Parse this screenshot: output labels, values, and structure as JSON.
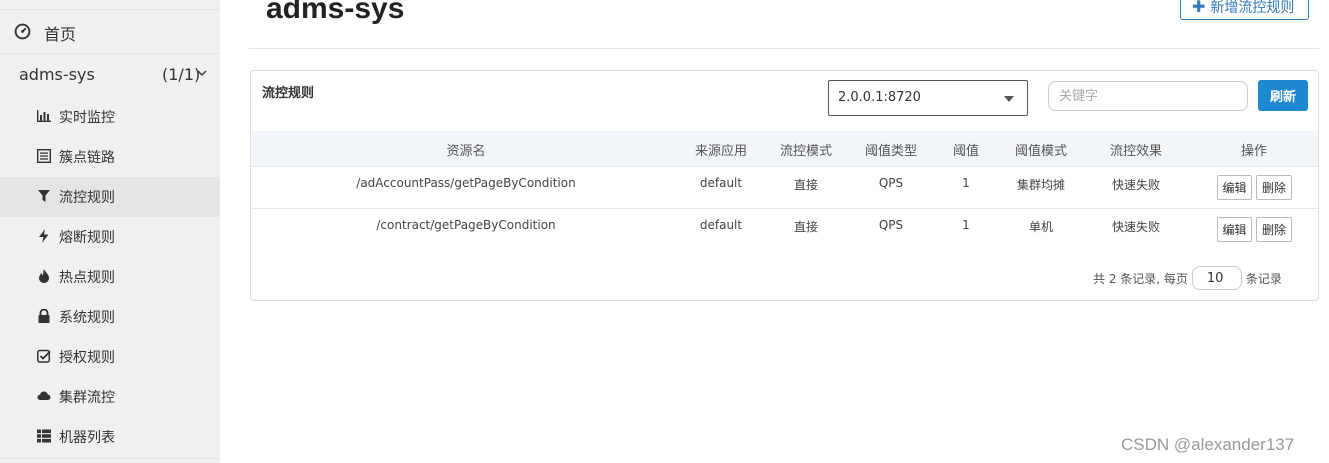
{
  "sidebar": {
    "home_label": "首页",
    "app_name": "adms-sys",
    "app_count": "(1/1)",
    "items": [
      {
        "label": "实时监控",
        "icon": "bar-chart-icon"
      },
      {
        "label": "簇点链路",
        "icon": "list-icon"
      },
      {
        "label": "流控规则",
        "icon": "filter-icon",
        "active": true
      },
      {
        "label": "熔断规则",
        "icon": "flash-icon"
      },
      {
        "label": "热点规则",
        "icon": "fire-icon"
      },
      {
        "label": "系统规则",
        "icon": "lock-icon"
      },
      {
        "label": "授权规则",
        "icon": "check-square-icon"
      },
      {
        "label": "集群流控",
        "icon": "cloud-icon"
      },
      {
        "label": "机器列表",
        "icon": "th-list-icon"
      }
    ]
  },
  "header": {
    "title": "adms-sys",
    "add_button": "新增流控规则",
    "add_icon": "plus-icon"
  },
  "panel": {
    "title": "流控规则",
    "machine_select": "2.0.0.1:8720",
    "keyword_placeholder": "关键字",
    "refresh_button": "刷新"
  },
  "table": {
    "columns": [
      "资源名",
      "来源应用",
      "流控模式",
      "阈值类型",
      "阈值",
      "阈值模式",
      "流控效果",
      "操作"
    ],
    "rows": [
      {
        "resource": "/adAccountPass/getPageByCondition",
        "limit_app": "default",
        "strategy": "直接",
        "grade": "QPS",
        "count": "1",
        "cluster_mode": "集群均摊",
        "control": "快速失败",
        "edit": "编辑",
        "delete": "删除"
      },
      {
        "resource": "/contract/getPageByCondition",
        "limit_app": "default",
        "strategy": "直接",
        "grade": "QPS",
        "count": "1",
        "cluster_mode": "单机",
        "control": "快速失败",
        "edit": "编辑",
        "delete": "删除"
      }
    ]
  },
  "pagination": {
    "total_text": "共 2 条记录, 每页",
    "page_size": "10",
    "suffix": "条记录"
  },
  "watermark": "CSDN @alexander137",
  "colors": {
    "primary": "#337ab7",
    "refresh": "#1e88d0",
    "sidebar_bg": "#f0f0f0",
    "table_header_bg": "#f2f6fa"
  }
}
